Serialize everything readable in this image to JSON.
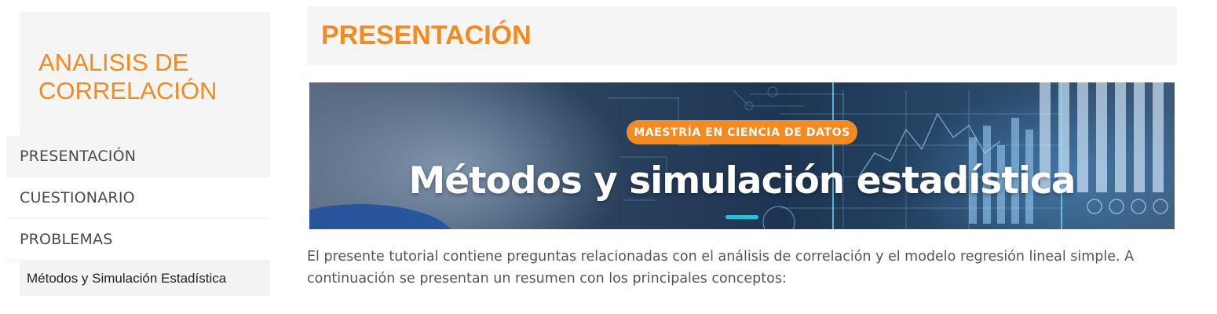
{
  "site": {
    "title": "ANALISIS DE CORRELACIÓN"
  },
  "nav": {
    "items": [
      {
        "label": "PRESENTACIÓN",
        "active": true
      },
      {
        "label": "CUESTIONARIO",
        "active": false
      },
      {
        "label": "PROBLEMAS",
        "active": false
      }
    ],
    "sub_item": "Métodos y Simulación Estadística"
  },
  "main": {
    "title": "PRESENTACIÓN",
    "banner": {
      "badge": "MAESTRÍA EN CIENCIA DE DATOS",
      "title": "Métodos y simulación estadística"
    },
    "intro": "El presente tutorial contiene preguntas relacionadas con el análisis de correlación y el modelo regresión lineal simple. A continuación se presentan un resumen con los principales conceptos:"
  },
  "colors": {
    "accent": "#f58a1f",
    "banner_bar": "#22c4d8"
  }
}
